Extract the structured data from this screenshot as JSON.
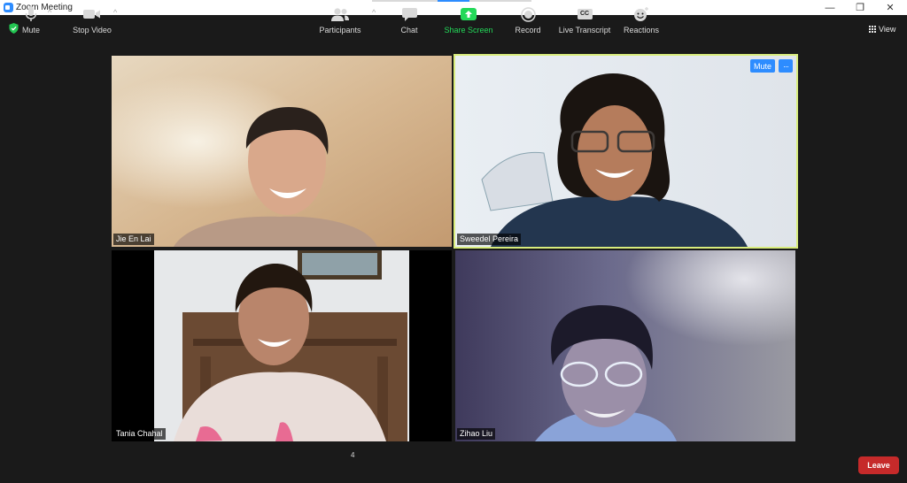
{
  "window": {
    "title": "Zoom Meeting",
    "controls": {
      "minimize": "—",
      "restore": "❐",
      "close": "✕"
    }
  },
  "top_bar": {
    "view_label": "View",
    "security_icon": "shield-check-icon"
  },
  "participants": [
    {
      "name": "Jie En Lai",
      "active_speaker": false
    },
    {
      "name": "Sweedel Pereira",
      "active_speaker": true,
      "mute_label": "Mute",
      "more_label": "···"
    },
    {
      "name": "Tania Chahal",
      "active_speaker": false
    },
    {
      "name": "Zihao Liu",
      "active_speaker": false
    }
  ],
  "toolbar": {
    "mute_label": "Mute",
    "stop_video_label": "Stop Video",
    "participants_label": "Participants",
    "participants_count": "4",
    "chat_label": "Chat",
    "share_screen_label": "Share Screen",
    "record_label": "Record",
    "live_transcript_label": "Live Transcript",
    "cc_label": "CC",
    "reactions_label": "Reactions",
    "leave_label": "Leave",
    "caret": "^"
  },
  "colors": {
    "accent": "#2d8cff",
    "active_speaker_border": "#d8ec7c",
    "share_green": "#23d959",
    "leave_red": "#c62a2a"
  }
}
